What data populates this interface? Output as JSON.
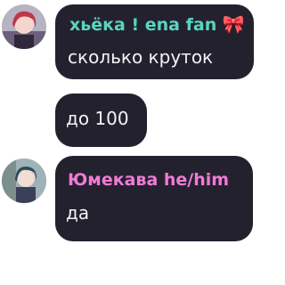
{
  "messages": [
    {
      "author": "хьёка ! ena fan",
      "author_emoji": "🎀",
      "author_color": "#57d6c0",
      "text": "сколько круток",
      "avatar_icon": "user-avatar-icon"
    },
    {
      "text": "до 100"
    },
    {
      "author": "Юмекава he/him",
      "author_color": "#f07ad6",
      "text": "да",
      "avatar_icon": "user-avatar-icon"
    }
  ],
  "colors": {
    "bubble_bg": "#24212f",
    "page_bg": "#ffffff",
    "text": "#f3f2f6"
  }
}
